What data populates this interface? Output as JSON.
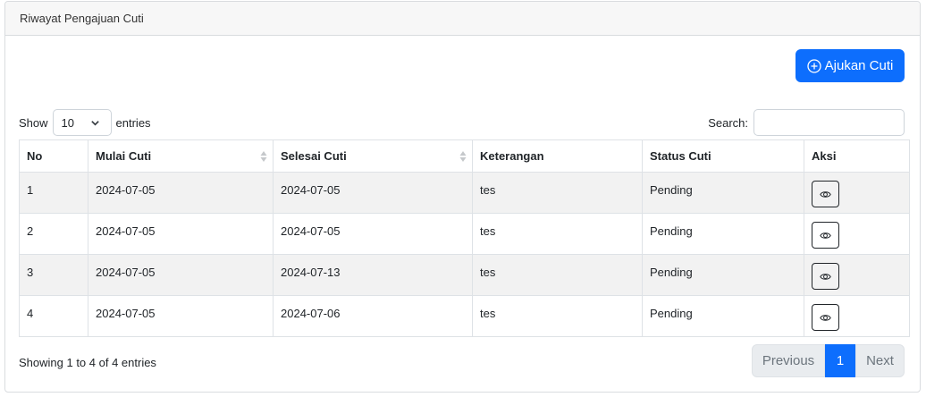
{
  "card": {
    "title": "Riwayat Pengajuan Cuti"
  },
  "toolbar": {
    "add_label": "Ajukan Cuti"
  },
  "length": {
    "show_label": "Show",
    "value": "10",
    "entries_label": "entries"
  },
  "search": {
    "label": "Search:",
    "value": ""
  },
  "table": {
    "headers": [
      "No",
      "Mulai Cuti",
      "Selesai Cuti",
      "Keterangan",
      "Status Cuti",
      "Aksi"
    ],
    "rows": [
      {
        "no": "1",
        "mulai": "2024-07-05",
        "selesai": "2024-07-05",
        "keterangan": "tes",
        "status": "Pending"
      },
      {
        "no": "2",
        "mulai": "2024-07-05",
        "selesai": "2024-07-05",
        "keterangan": "tes",
        "status": "Pending"
      },
      {
        "no": "3",
        "mulai": "2024-07-05",
        "selesai": "2024-07-13",
        "keterangan": "tes",
        "status": "Pending"
      },
      {
        "no": "4",
        "mulai": "2024-07-05",
        "selesai": "2024-07-06",
        "keterangan": "tes",
        "status": "Pending"
      }
    ]
  },
  "info": "Showing 1 to 4 of 4 entries",
  "pagination": {
    "previous": "Previous",
    "current": "1",
    "next": "Next"
  },
  "icons": {
    "add": "plus-circle-icon",
    "view": "eye-icon",
    "sort": "sort-icon",
    "dropdown": "chevron-down-icon"
  },
  "colors": {
    "primary": "#0d6efd",
    "stripe": "#f2f2f2",
    "disabled": "#e9ecef"
  }
}
